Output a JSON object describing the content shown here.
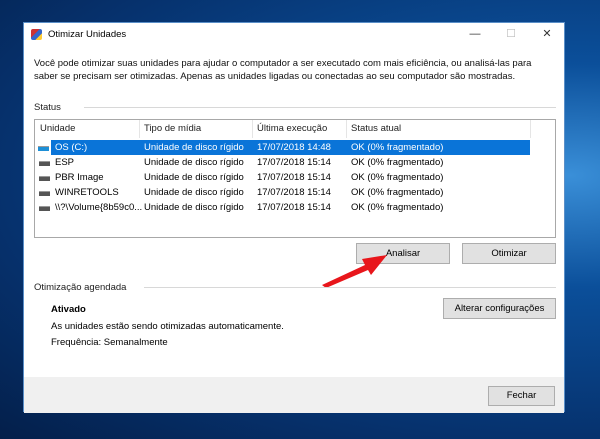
{
  "window": {
    "title": "Otimizar Unidades",
    "minimize": "—",
    "maximize": "☐",
    "close": "✕"
  },
  "description": "Você pode otimizar suas unidades para ajudar o computador a ser executado com mais eficiência, ou analisá-las para saber se precisam ser otimizadas. Apenas as unidades ligadas ou conectadas ao seu computador são mostradas.",
  "status": {
    "label": "Status",
    "columns": [
      "Unidade",
      "Tipo de mídia",
      "Última execução",
      "Status atual"
    ],
    "rows": [
      {
        "drive": "OS (C:)",
        "media": "Unidade de disco rígido",
        "last": "17/07/2018 14:48",
        "status": "OK (0% fragmentado)",
        "selected": true
      },
      {
        "drive": "ESP",
        "media": "Unidade de disco rígido",
        "last": "17/07/2018 15:14",
        "status": "OK (0% fragmentado)"
      },
      {
        "drive": "PBR Image",
        "media": "Unidade de disco rígido",
        "last": "17/07/2018 15:14",
        "status": "OK (0% fragmentado)"
      },
      {
        "drive": "WINRETOOLS",
        "media": "Unidade de disco rígido",
        "last": "17/07/2018 15:14",
        "status": "OK (0% fragmentado)"
      },
      {
        "drive": "\\\\?\\Volume{8b59c0...",
        "media": "Unidade de disco rígido",
        "last": "17/07/2018 15:14",
        "status": "OK (0% fragmentado)"
      }
    ],
    "analyze": "Analisar",
    "optimize": "Otimizar"
  },
  "schedule": {
    "label": "Otimização agendada",
    "state": "Ativado",
    "info": "As unidades estão sendo otimizadas automaticamente.",
    "frequency": "Frequência: Semanalmente",
    "change": "Alterar configurações"
  },
  "close_button": "Fechar",
  "colors": {
    "selection": "#0a74d8",
    "arrow": "#e8161b"
  }
}
